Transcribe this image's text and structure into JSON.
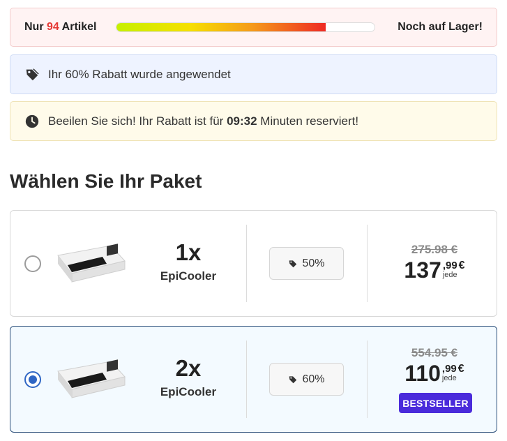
{
  "stock": {
    "prefix": "Nur",
    "count": "94",
    "suffix": "Artikel",
    "progress_percent": 81,
    "right_label": "Noch auf Lager!"
  },
  "discount": {
    "icon": "tag-icon",
    "text": "Ihr 60% Rabatt wurde angewendet"
  },
  "timer": {
    "icon": "clock-icon",
    "text_before": "Beeilen Sie sich! Ihr Rabatt ist für",
    "time": "09:32",
    "text_after": "Minuten reserviert!"
  },
  "heading": "Wählen Sie Ihr Paket",
  "packages": [
    {
      "selected": false,
      "quantity": "1x",
      "product": "EpiCooler",
      "discount": "50%",
      "old_price": "275.98 €",
      "price_main": "137",
      "price_fraction": ",99",
      "price_unit": "jede",
      "currency": "€"
    },
    {
      "selected": true,
      "quantity": "2x",
      "product": "EpiCooler",
      "discount": "60%",
      "old_price": "554.95 €",
      "price_main": "110",
      "price_fraction": ",99",
      "price_unit": "jede",
      "currency": "€",
      "badge": "BESTSELLER"
    }
  ],
  "colors": {
    "stock_number": "#e53935",
    "selected_accent": "#2f66c4",
    "bestseller": "#4a2bdb"
  }
}
